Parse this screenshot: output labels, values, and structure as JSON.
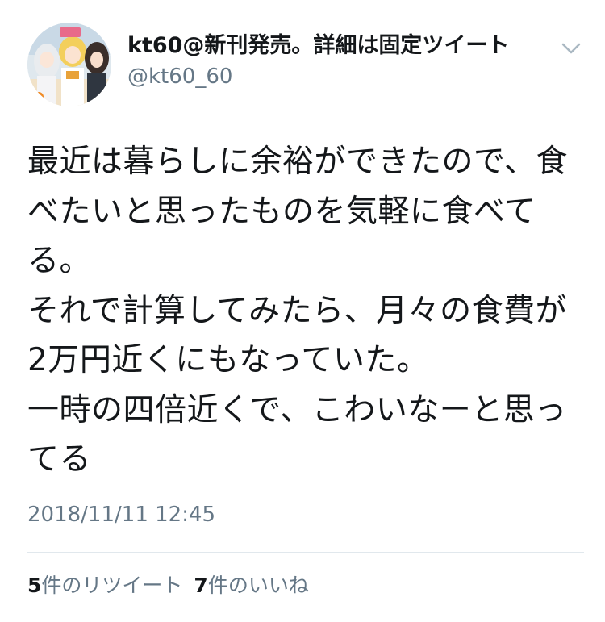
{
  "user": {
    "display_name": "kt60@新刊発売。詳細は固定ツイート",
    "handle": "@kt60_60",
    "avatar_icon": "user-avatar-anime-illustration"
  },
  "menu_icon": "chevron-down-icon",
  "tweet": {
    "text": "最近は暮らしに余裕ができたので、食べたいと思ったものを気軽に食べてる。\nそれで計算してみたら、月々の食費が2万円近くにもなっていた。\n一時の四倍近くで、こわいなーと思ってる",
    "timestamp": "2018/11/11 12:45"
  },
  "stats": {
    "retweets_count": "5",
    "retweets_label": "件のリツイート",
    "likes_count": "7",
    "likes_label": "件のいいね"
  },
  "colors": {
    "text_primary": "#14171a",
    "text_secondary": "#657786",
    "divider": "#e1e8ed",
    "background": "#ffffff"
  }
}
